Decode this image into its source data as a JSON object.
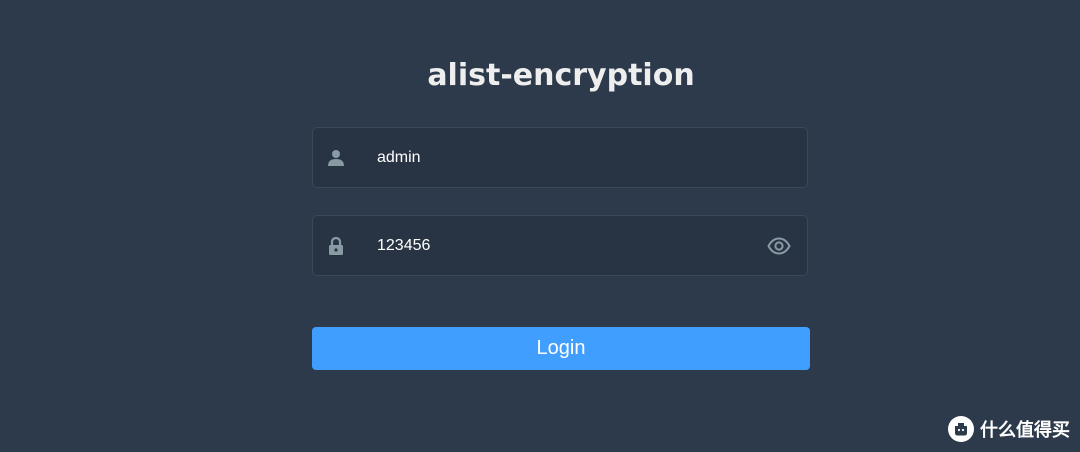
{
  "app": {
    "title": "alist-encryption"
  },
  "login_form": {
    "username": {
      "value": "admin",
      "icon": "user-icon"
    },
    "password": {
      "value": "123456",
      "icon": "lock-icon",
      "toggle_icon": "eye-icon"
    },
    "login_label": "Login"
  },
  "watermark": {
    "text": "什么值得买",
    "logo": "smzdm-logo"
  },
  "colors": {
    "background": "#2d3a4b",
    "field_background": "#283443",
    "field_border": "#3c4757",
    "icon": "#889aa4",
    "accent": "#409eff",
    "title": "#eeeeee"
  }
}
